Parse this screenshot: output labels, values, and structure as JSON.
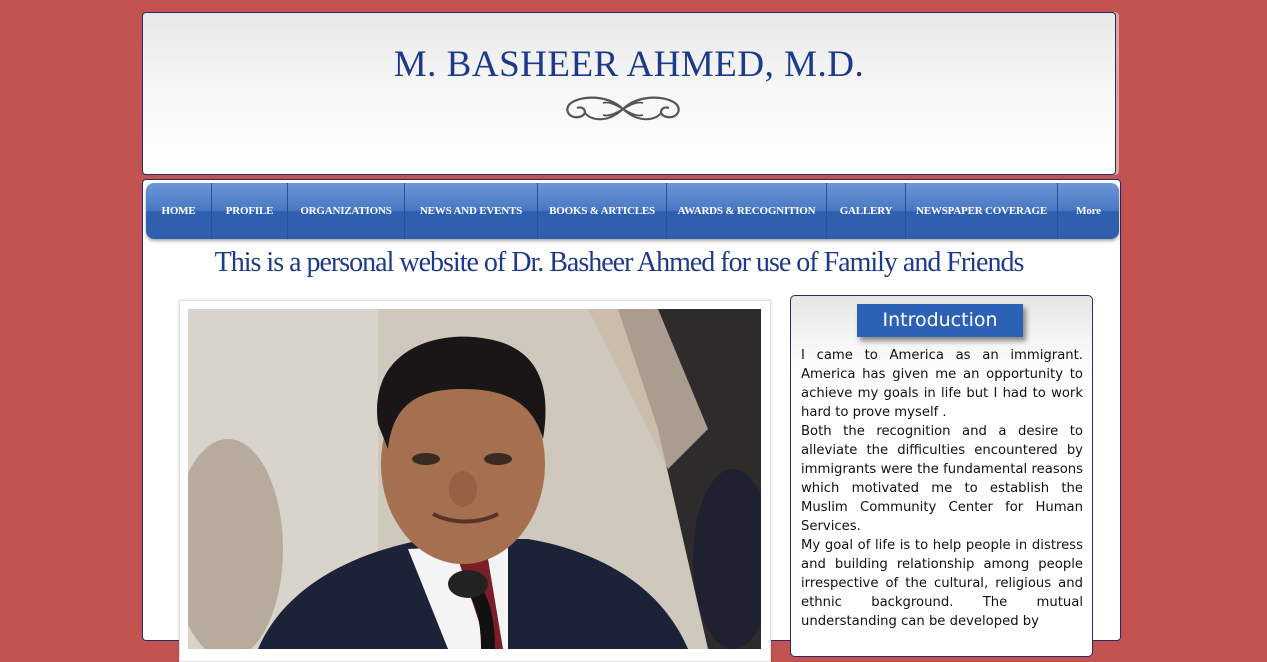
{
  "header": {
    "site_title": "M. BASHEER AHMED, M.D."
  },
  "nav": {
    "items": [
      {
        "label": "HOME"
      },
      {
        "label": "PROFILE"
      },
      {
        "label": "ORGANIZATIONS"
      },
      {
        "label": "NEWS AND EVENTS"
      },
      {
        "label": "BOOKS & ARTICLES"
      },
      {
        "label": "AWARDS & RECOGNITION"
      },
      {
        "label": "GALLERY"
      },
      {
        "label": "NEWSPAPER COVERAGE"
      },
      {
        "label": "More"
      }
    ]
  },
  "main": {
    "tagline": "This is a personal website of Dr. Basheer Ahmed for use of Family and Friends"
  },
  "intro": {
    "heading": "Introduction",
    "paragraphs": [
      "I came to America as an immigrant. America has given me an opportunity to achieve my goals in life but I had to work hard to prove myself .",
      "Both the recognition and a desire to alleviate the difficulties encountered by immigrants were the fundamental reasons which motivated me to establish the Muslim Community Center for Human Services.",
      "My goal of life is to help people in distress and building relationship among people irrespective of the cultural, religious and ethnic background. The mutual understanding can be developed by"
    ]
  },
  "colors": {
    "page_background": "#c25350",
    "title_blue": "#1c3a8a",
    "nav_blue": "#2f5fae",
    "intro_heading_blue": "#2c61b5"
  }
}
